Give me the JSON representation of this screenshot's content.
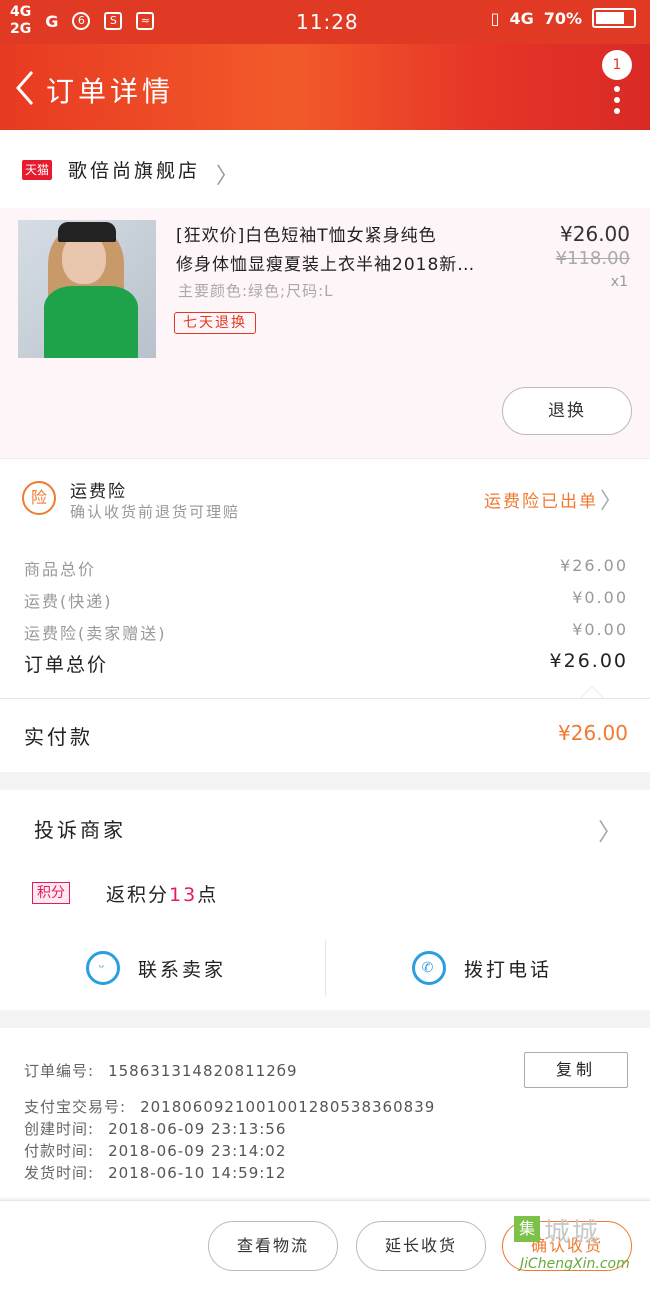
{
  "status_bar": {
    "net_1": "4G",
    "net_2": "2G",
    "net_3": "G",
    "time": "11:28",
    "net_4": "4G",
    "battery": "70%"
  },
  "nav": {
    "title": "订单详情",
    "badge": "1"
  },
  "store": {
    "tag": "天猫",
    "name": "歌倍尚旗舰店"
  },
  "product": {
    "title_line1": "[狂欢价]白色短袖T恤女紧身纯色",
    "title_line2": "修身体恤显瘦夏装上衣半袖2018新…",
    "sku": "主要颜色:绿色;尺码:L",
    "tag": "七天退换",
    "price": "¥26.00",
    "original_price": "¥118.00",
    "quantity": "x1",
    "refund_button": "退换"
  },
  "insurance": {
    "icon": "险",
    "title": "运费险",
    "subtitle": "确认收货前退货可理赔",
    "status": "运费险已出单"
  },
  "fees": {
    "items": [
      {
        "label": "商品总价",
        "value": "¥26.00"
      },
      {
        "label": "运费(快递)",
        "value": "¥0.00"
      },
      {
        "label": "运费险(卖家赠送)",
        "value": "¥0.00"
      }
    ],
    "total_label": "订单总价",
    "total_value": "¥26.00"
  },
  "paid": {
    "label": "实付款",
    "value": "¥26.00"
  },
  "complain": {
    "label": "投诉商家",
    "points_tag": "积分",
    "points_prefix": "返积分",
    "points_num": "13",
    "points_suffix": "点"
  },
  "contact": {
    "seller_label": "联系卖家",
    "phone_label": "拨打电话"
  },
  "order_info": {
    "order_no_label": "订单编号:",
    "order_no": "1586313148208112б9",
    "copy_button": "复制",
    "alipay_label": "支付宝交易号:",
    "alipay_no": "2018060921001001280538360839",
    "created_label": "创建时间:",
    "created": "2018-06-09 23:13:56",
    "paid_label": "付款时间:",
    "paid": "2018-06-09 23:14:02",
    "shipped_label": "发货时间:",
    "shipped": "2018-06-10 14:59:12"
  },
  "bottom": {
    "logistics": "查看物流",
    "extend": "延长收货",
    "confirm": "确认收货"
  },
  "watermark": {
    "logo": "集",
    "brand": "城城",
    "url": "JiChengXin.com"
  },
  "colors": {
    "brand_red": "#e03a24",
    "accent_orange": "#f07a30",
    "link_blue": "#2a9ee0",
    "points_pink": "#e61b5d"
  }
}
